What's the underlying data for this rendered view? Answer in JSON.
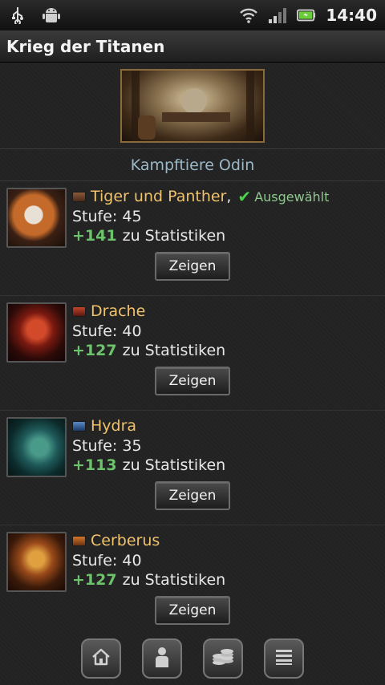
{
  "status_bar": {
    "icons_left": [
      "usb-icon",
      "android-debug-icon"
    ],
    "icons_right": [
      "wifi-icon",
      "signal-icon",
      "battery-icon"
    ],
    "clock": "14:40"
  },
  "app": {
    "title": "Krieg der Titanen"
  },
  "section": {
    "title": "Kampftiere Odin"
  },
  "pets": [
    {
      "name": "Tiger und Panther",
      "comma": ",",
      "selected_label": "Ausgewählt",
      "selected": true,
      "level_label": "Stufe: 45",
      "bonus": "+141",
      "stats_label": "zu Statistiken",
      "button": "Zeigen",
      "chest_icon": "chest-brown-icon"
    },
    {
      "name": "Drache",
      "level_label": "Stufe: 40",
      "bonus": "+127",
      "stats_label": "zu Statistiken",
      "button": "Zeigen",
      "chest_icon": "chest-red-icon"
    },
    {
      "name": "Hydra",
      "level_label": "Stufe: 35",
      "bonus": "+113",
      "stats_label": "zu Statistiken",
      "button": "Zeigen",
      "chest_icon": "chest-blue-icon"
    },
    {
      "name": "Cerberus",
      "level_label": "Stufe: 40",
      "bonus": "+127",
      "stats_label": "zu Statistiken",
      "button": "Zeigen",
      "chest_icon": "chest-orange-icon"
    }
  ],
  "bottom_nav": [
    "home-icon",
    "profile-icon",
    "coins-icon",
    "menu-icon"
  ],
  "colors": {
    "pet_name": "#f0c26a",
    "bonus": "#6cc36c",
    "section_title": "#9ab8c8",
    "selected_check": "#4bd34b"
  }
}
